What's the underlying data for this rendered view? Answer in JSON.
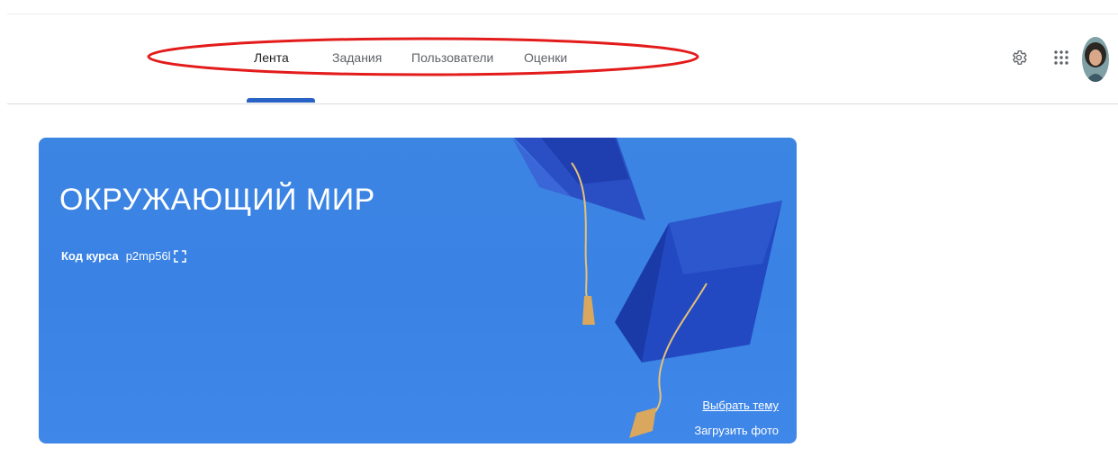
{
  "nav": {
    "tabs": [
      {
        "label": "Лента",
        "active": true
      },
      {
        "label": "Задания",
        "active": false
      },
      {
        "label": "Пользователи",
        "active": false
      },
      {
        "label": "Оценки",
        "active": false
      }
    ],
    "highlight_color": "#e31b1b"
  },
  "header_actions": {
    "settings_icon": "gear-icon",
    "apps_icon": "apps-grid-icon",
    "avatar": "user-avatar"
  },
  "banner": {
    "title": "ОКРУЖАЮЩИЙ МИР",
    "course_code_label": "Код курса",
    "course_code": "p2mp56l",
    "expand_icon": "fullscreen-icon",
    "choose_theme": "Выбрать тему",
    "upload_photo": "Загрузить фото",
    "background_color": "#3b84e5",
    "illustration": "graduation-caps"
  },
  "colors": {
    "accent": "#2a63c6",
    "tab_text": "#5f6368",
    "active_tab_text": "#1f1f1f"
  }
}
